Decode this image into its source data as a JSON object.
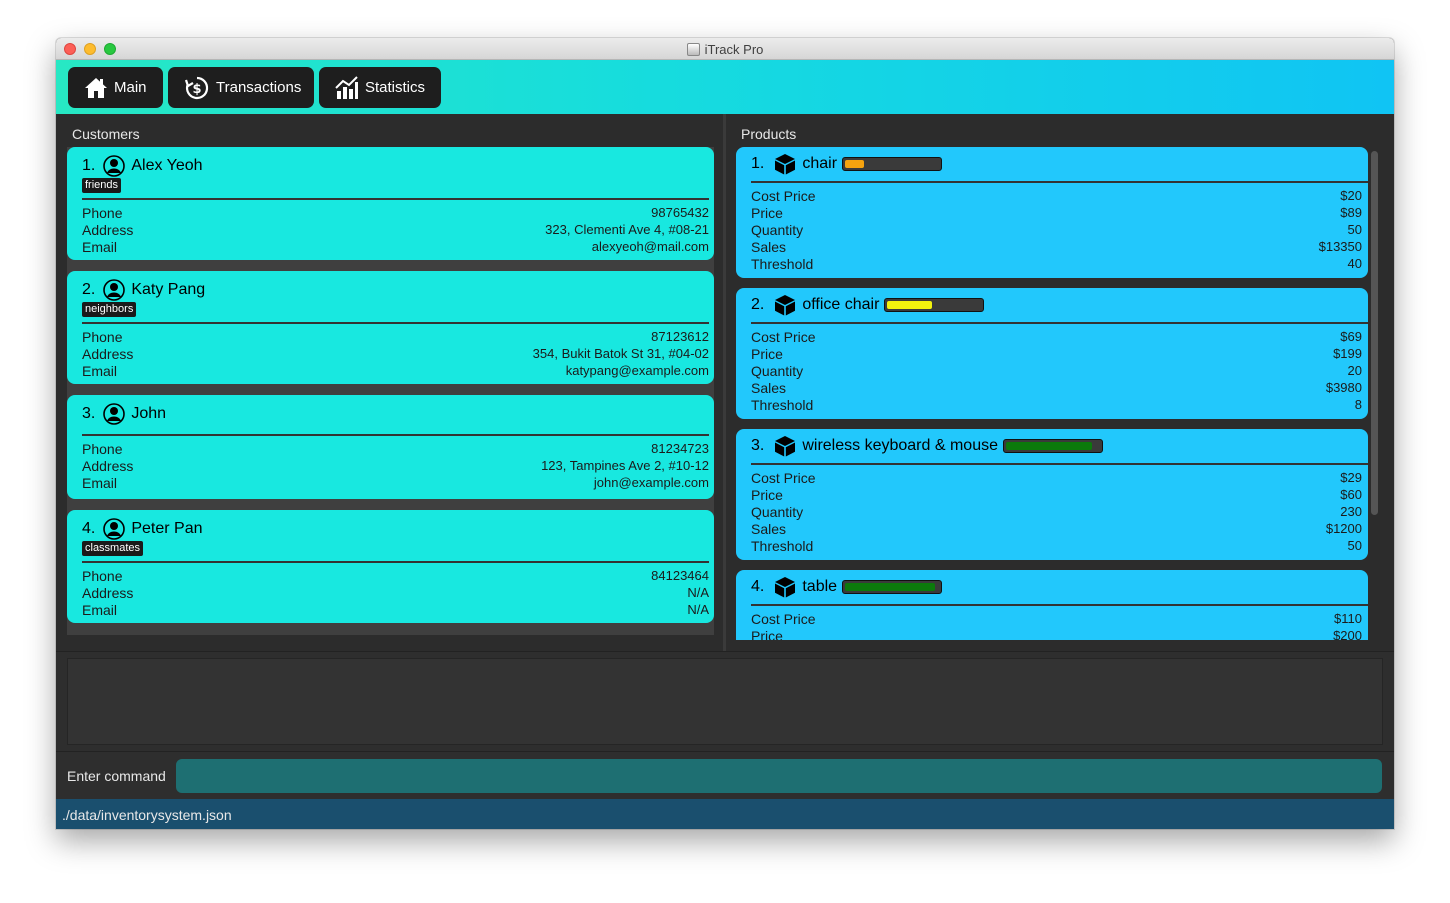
{
  "window": {
    "title": "iTrack Pro"
  },
  "tabs": {
    "main": "Main",
    "transactions": "Transactions",
    "statistics": "Statistics"
  },
  "customers": {
    "title": "Customers",
    "field_labels": {
      "phone": "Phone",
      "address": "Address",
      "email": "Email"
    },
    "items": [
      {
        "index": "1.",
        "name": "Alex Yeoh",
        "tag": "friends",
        "phone": "98765432",
        "address": "323, Clementi Ave 4, #08-21",
        "email": "alexyeoh@mail.com"
      },
      {
        "index": "2.",
        "name": "Katy Pang",
        "tag": "neighbors",
        "phone": "87123612",
        "address": "354, Bukit Batok St 31, #04-02",
        "email": "katypang@example.com"
      },
      {
        "index": "3.",
        "name": "John",
        "tag": "",
        "phone": "81234723",
        "address": "123, Tampines Ave 2, #10-12",
        "email": "john@example.com"
      },
      {
        "index": "4.",
        "name": "Peter Pan",
        "tag": "classmates",
        "phone": "84123464",
        "address": "N/A",
        "email": "N/A"
      }
    ]
  },
  "products": {
    "title": "Products",
    "field_labels": {
      "cost": "Cost Price",
      "price": "Price",
      "quantity": "Quantity",
      "sales": "Sales",
      "threshold": "Threshold"
    },
    "items": [
      {
        "index": "1.",
        "name": "chair",
        "stock_level": 0.2,
        "stock_color": "#f5a30f",
        "cost": "$20",
        "price": "$89",
        "quantity": "50",
        "sales": "$13350",
        "threshold": "40"
      },
      {
        "index": "2.",
        "name": "office chair",
        "stock_level": 0.48,
        "stock_color": "#f2f20e",
        "cost": "$69",
        "price": "$199",
        "quantity": "20",
        "sales": "$3980",
        "threshold": "8"
      },
      {
        "index": "3.",
        "name": "wireless keyboard & mouse",
        "stock_level": 0.92,
        "stock_color": "#0b7a0b",
        "cost": "$29",
        "price": "$60",
        "quantity": "230",
        "sales": "$1200",
        "threshold": "50"
      },
      {
        "index": "4.",
        "name": "table",
        "stock_level": 0.96,
        "stock_color": "#0b7a0b",
        "cost": "$110",
        "price": "$200",
        "quantity": "",
        "sales": "",
        "threshold": ""
      }
    ]
  },
  "command": {
    "label": "Enter command",
    "value": ""
  },
  "status": {
    "path": "./data/inventorysystem.json"
  }
}
